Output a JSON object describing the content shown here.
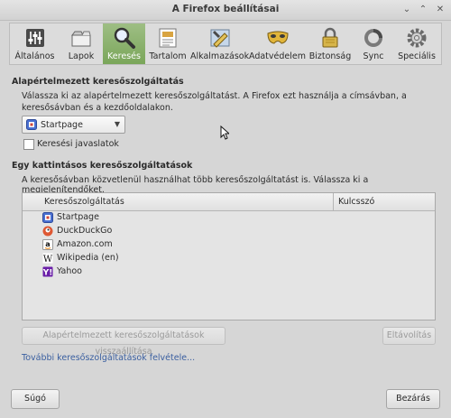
{
  "window": {
    "title": "A Firefox beállításai",
    "controls": {
      "minimize": "⌄",
      "maximize": "⌃",
      "close": "✕"
    }
  },
  "toolbar": {
    "tabs": [
      {
        "label": "Általános",
        "icon": "general-icon"
      },
      {
        "label": "Lapok",
        "icon": "tabs-icon"
      },
      {
        "label": "Keresés",
        "icon": "search-icon",
        "active": true
      },
      {
        "label": "Tartalom",
        "icon": "content-icon"
      },
      {
        "label": "Alkalmazások",
        "icon": "applications-icon"
      },
      {
        "label": "Adatvédelem",
        "icon": "privacy-mask-icon"
      },
      {
        "label": "Biztonság",
        "icon": "lock-icon"
      },
      {
        "label": "Sync",
        "icon": "sync-icon"
      },
      {
        "label": "Speciális",
        "icon": "gear-icon"
      }
    ]
  },
  "default_search": {
    "title": "Alapértelmezett keresőszolgáltatás",
    "description": "Válassza ki az alapértelmezett keresőszolgáltatást. A Firefox ezt használja a címsávban, a keresősávban és a kezdőoldalakon.",
    "selected_engine": "Startpage",
    "suggestions_label": "Keresési javaslatok",
    "suggestions_checked": false
  },
  "one_click": {
    "title": "Egy kattintásos keresőszolgáltatások",
    "description": "A keresősávban közvetlenül használhat több keresőszolgáltatást is. Válassza ki a megjelenítendőket.",
    "columns": [
      "Keresőszolgáltatás",
      "Kulcsszó"
    ],
    "engines": [
      {
        "name": "Startpage",
        "icon": "startpage-icon",
        "keyword": ""
      },
      {
        "name": "DuckDuckGo",
        "icon": "duckduckgo-icon",
        "keyword": ""
      },
      {
        "name": "Amazon.com",
        "icon": "amazon-icon",
        "keyword": ""
      },
      {
        "name": "Wikipedia (en)",
        "icon": "wikipedia-icon",
        "keyword": ""
      },
      {
        "name": "Yahoo",
        "icon": "yahoo-icon",
        "keyword": ""
      }
    ],
    "restore_label": "Alapértelmezett keresőszolgáltatások visszaállítása",
    "remove_label": "Eltávolítás",
    "add_more_link": "További keresőszolgáltatások felvétele..."
  },
  "footer": {
    "help_label": "Súgó",
    "close_label": "Bezárás"
  },
  "colors": {
    "active_tab": "#86ad68",
    "link": "#3a5fa0",
    "background": "#d6d6d6"
  }
}
